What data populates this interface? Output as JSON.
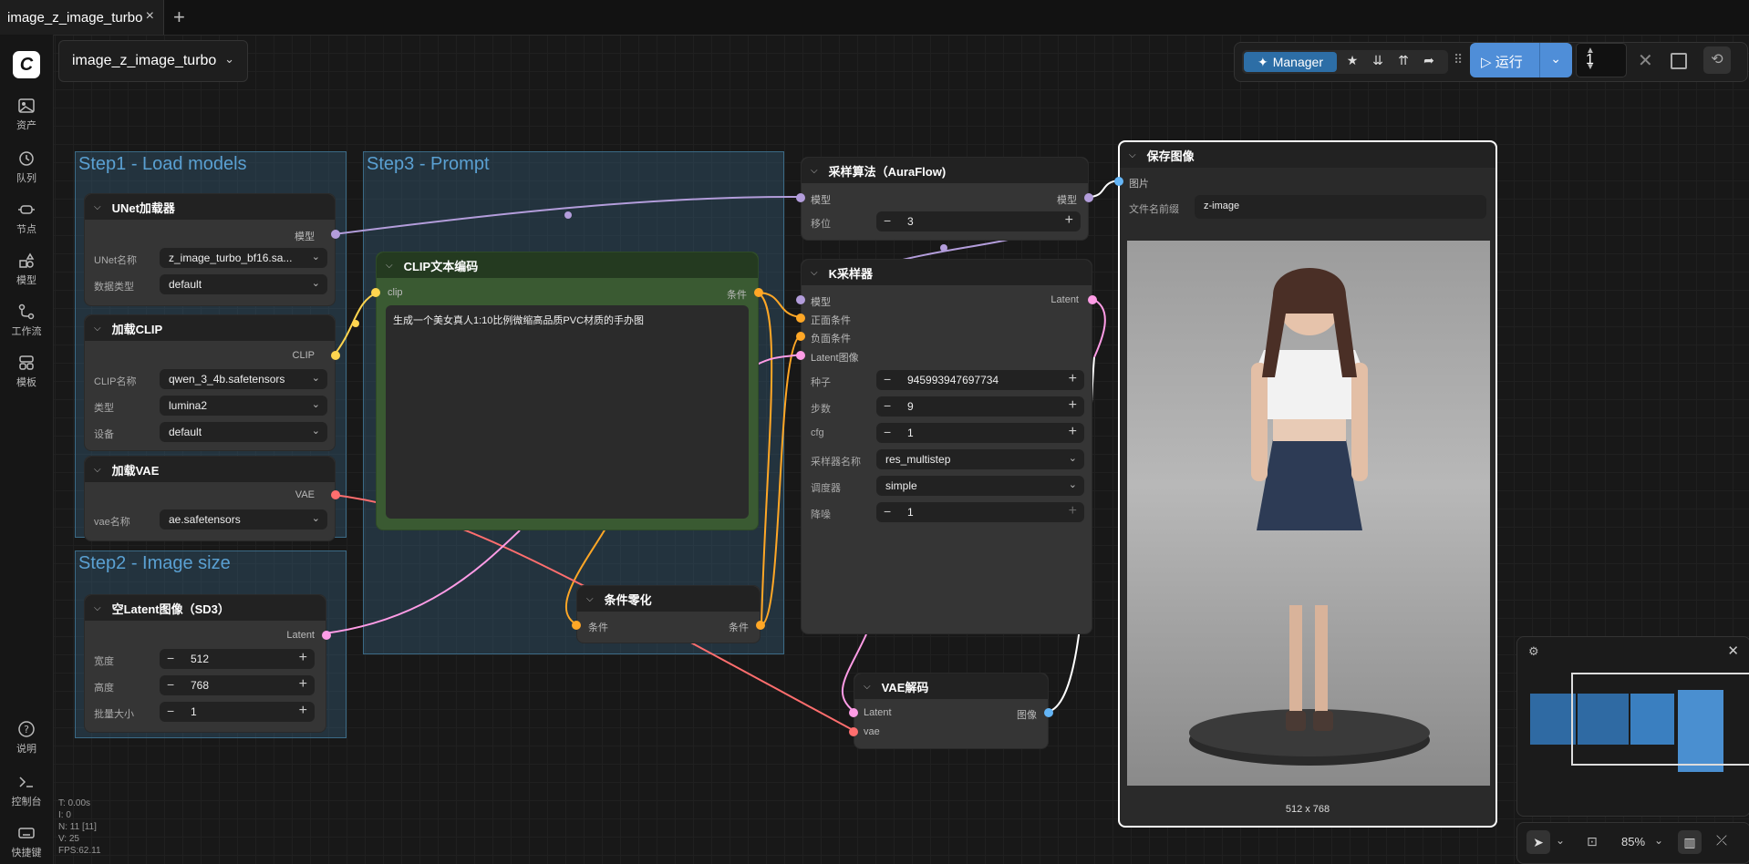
{
  "tab": {
    "title": "image_z_image_turbo",
    "close_icon": "×",
    "add_icon": "+"
  },
  "sidebar": {
    "logo": "C",
    "items": [
      {
        "label": "资产",
        "icon": "image-icon"
      },
      {
        "label": "队列",
        "icon": "history-icon"
      },
      {
        "label": "节点",
        "icon": "node-icon"
      },
      {
        "label": "模型",
        "icon": "model-icon"
      },
      {
        "label": "工作流",
        "icon": "workflow-icon"
      },
      {
        "label": "模板",
        "icon": "template-icon"
      }
    ],
    "bottom_items": [
      {
        "label": "说明",
        "icon": "help-icon"
      },
      {
        "label": "控制台",
        "icon": "terminal-icon"
      },
      {
        "label": "快捷键",
        "icon": "keyboard-icon"
      }
    ]
  },
  "workflow_selector": {
    "value": "image_z_image_turbo"
  },
  "toolbar": {
    "manager_label": "Manager",
    "run_label": "运行",
    "queue_count": "1"
  },
  "groups": {
    "step1": "Step1 - Load models",
    "step2": "Step2 - Image size",
    "step3": "Step3 - Prompt"
  },
  "nodes": {
    "unet": {
      "title": "UNet加载器",
      "output": "模型",
      "fields": [
        {
          "label": "UNet名称",
          "value": "z_image_turbo_bf16.sa..."
        },
        {
          "label": "数据类型",
          "value": "default"
        }
      ]
    },
    "clip_loader": {
      "title": "加载CLIP",
      "output": "CLIP",
      "fields": [
        {
          "label": "CLIP名称",
          "value": "qwen_3_4b.safetensors"
        },
        {
          "label": "类型",
          "value": "lumina2"
        },
        {
          "label": "设备",
          "value": "default"
        }
      ]
    },
    "vae_loader": {
      "title": "加载VAE",
      "output": "VAE",
      "fields": [
        {
          "label": "vae名称",
          "value": "ae.safetensors"
        }
      ]
    },
    "latent": {
      "title": "空Latent图像（SD3）",
      "output": "Latent",
      "fields": [
        {
          "label": "宽度",
          "value": "512"
        },
        {
          "label": "高度",
          "value": "768"
        },
        {
          "label": "批量大小",
          "value": "1"
        }
      ]
    },
    "clip_text": {
      "title": "CLIP文本编码",
      "input": "clip",
      "output": "条件",
      "prompt": "生成一个美女真人1:10比例微缩高品质PVC材质的手办图"
    },
    "cond_zero": {
      "title": "条件零化",
      "input": "条件",
      "output": "条件"
    },
    "aura": {
      "title": "采样算法（AuraFlow)",
      "input": "模型",
      "output": "模型",
      "fields": [
        {
          "label": "移位",
          "value": "3"
        }
      ]
    },
    "ksampler": {
      "title": "K采样器",
      "inputs": [
        "模型",
        "正面条件",
        "负面条件",
        "Latent图像"
      ],
      "output": "Latent",
      "fields": [
        {
          "label": "种子",
          "value": "945993947697734"
        },
        {
          "label": "步数",
          "value": "9"
        },
        {
          "label": "cfg",
          "value": "1"
        },
        {
          "label": "采样器名称",
          "value": "res_multistep"
        },
        {
          "label": "调度器",
          "value": "simple"
        },
        {
          "label": "降噪",
          "value": "1"
        }
      ]
    },
    "vae_decode": {
      "title": "VAE解码",
      "inputs": [
        "Latent",
        "vae"
      ],
      "output": "图像"
    },
    "save": {
      "title": "保存图像",
      "input": "图片",
      "prefix_label": "文件名前缀",
      "prefix_value": "z-image",
      "image_size": "512 x 768"
    }
  },
  "zoom": {
    "level": "85%"
  },
  "stats": {
    "t": "T: 0.00s",
    "i": "I: 0",
    "n": "N: 11 [11]",
    "v": "V: 25",
    "fps": "FPS:62.11"
  },
  "colors": {
    "model": "#b39ddb",
    "clip": "#ffd54f",
    "conditioning": "#ffa726",
    "vae": "#ff6e6e",
    "latent": "#ff9ce6",
    "image": "#64b5f6",
    "accent": "#4f8ed8"
  }
}
